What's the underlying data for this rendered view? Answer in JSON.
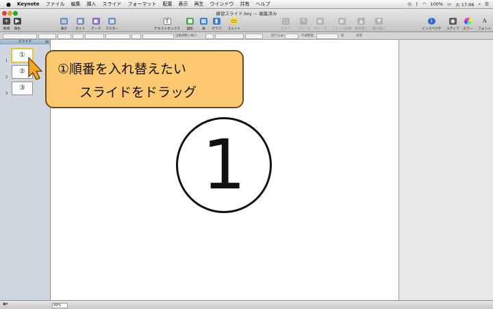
{
  "menubar": {
    "app": "Keynote",
    "items": [
      "ファイル",
      "編集",
      "挿入",
      "スライド",
      "フォーマット",
      "配置",
      "表示",
      "再生",
      "ウインドウ",
      "共有",
      "ヘルプ"
    ],
    "battery": "100%",
    "clock": "火 17:06"
  },
  "window": {
    "title": "練習スライド.key — 編集済み"
  },
  "toolbar": {
    "new": "新規",
    "play": "再生",
    "view": "表示",
    "guide": "ガイド",
    "theme": "テーマ",
    "master": "マスター",
    "textbox": "テキストボックス",
    "shape": "図形",
    "table": "表",
    "chart": "グラフ",
    "comment": "コメント",
    "mask": "マスク",
    "alpha": "アルファ",
    "group": "グループ",
    "ungroup": "グループ解除",
    "front": "最前面へ",
    "back": "最背面へ",
    "inspector": "インスペクタ",
    "media": "メディア",
    "colors": "カラー",
    "fonts": "フォント"
  },
  "formatbar": {
    "autosize": "自動調整に縮小",
    "wrap": "回り込み:",
    "opacity": "不透明度",
    "shadow": "影",
    "reflection": "反射"
  },
  "sidebar": {
    "header": "スライド",
    "slides": [
      {
        "number": "1",
        "label": "①"
      },
      {
        "number": "2",
        "label": "②"
      },
      {
        "number": "3",
        "label": "③"
      }
    ]
  },
  "slide": {
    "main_text": "1"
  },
  "callout": {
    "line1": "①順番を入れ替えたい",
    "line2": "スライドをドラッグ"
  },
  "bottombar": {
    "zoom": "99%"
  },
  "colors": {
    "callout_fill": "#fcc971",
    "selection": "#e7c43d",
    "cursor": "#f5a623"
  }
}
